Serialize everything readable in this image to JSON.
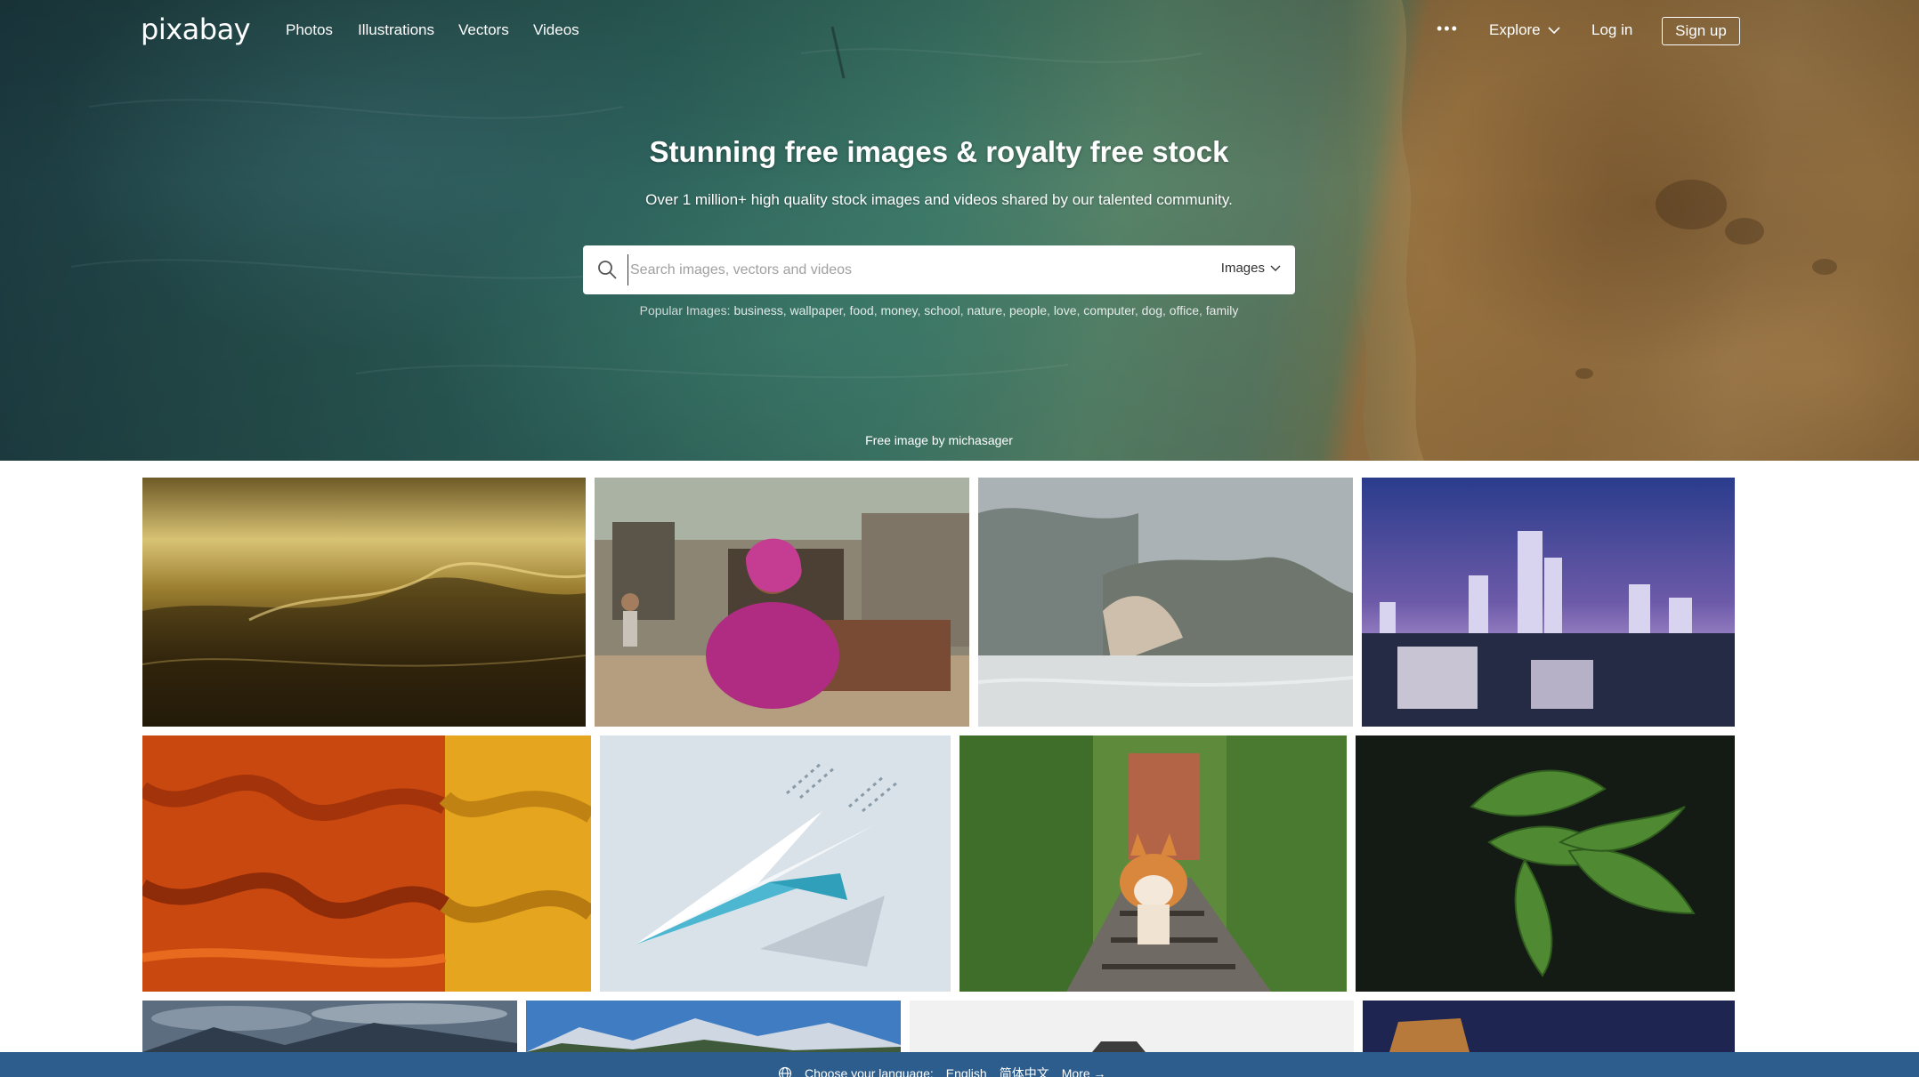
{
  "nav": {
    "logo": "pixabay",
    "links": [
      "Photos",
      "Illustrations",
      "Vectors",
      "Videos"
    ],
    "more": "•••",
    "explore": "Explore",
    "login": "Log in",
    "signup": "Sign up"
  },
  "hero": {
    "title": "Stunning free images & royalty free stock",
    "subtitle": "Over 1 million+ high quality stock images and videos shared by our talented community.",
    "search_placeholder": "Search images, vectors and videos",
    "search_type": "Images",
    "popular_label": "Popular Images:",
    "popular_tags": [
      "business",
      "wallpaper",
      "food",
      "money",
      "school",
      "nature",
      "people",
      "love",
      "computer",
      "dog",
      "office",
      "family"
    ],
    "credit": "Free image by michasager"
  },
  "gallery": {
    "images": [
      {
        "subject": "golden ocean wave at sunset"
      },
      {
        "subject": "smiling woman in pink sari"
      },
      {
        "subject": "misty coastal cliffs"
      },
      {
        "subject": "city skyline at dusk"
      },
      {
        "subject": "orange and yellow fabric"
      },
      {
        "subject": "paper plane illustration"
      },
      {
        "subject": "corgi on railway tracks"
      },
      {
        "subject": "green leaves on dark background"
      },
      {
        "subject": "cloudy mountain landscape"
      },
      {
        "subject": "snowy mountain range"
      },
      {
        "subject": "minimal grey object"
      },
      {
        "subject": "night building"
      }
    ]
  },
  "language_bar": {
    "label": "Choose your language:",
    "options": [
      "English",
      "简体中文"
    ],
    "more": "More →"
  }
}
